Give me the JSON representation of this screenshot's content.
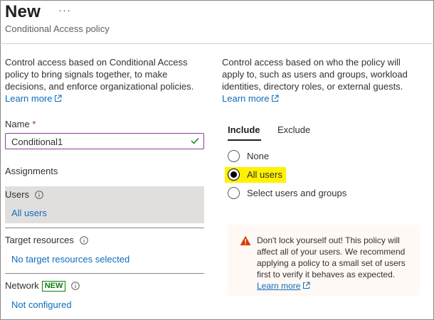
{
  "header": {
    "title": "New",
    "more_label": "···",
    "subtitle": "Conditional Access policy"
  },
  "left": {
    "description": "Control access based on Conditional Access policy to bring signals together, to make decisions, and enforce organizational policies.",
    "learn_more": "Learn more",
    "name_label": "Name",
    "required_marker": "*",
    "name_value": "Conditional1",
    "assignments_label": "Assignments",
    "users": {
      "title": "Users",
      "value": "All users"
    },
    "target_resources": {
      "title": "Target resources",
      "value": "No target resources selected"
    },
    "network": {
      "title": "Network",
      "badge": "NEW",
      "value": "Not configured"
    }
  },
  "right": {
    "description": "Control access based on who the policy will apply to, such as users and groups, workload identities, directory roles, or external guests.",
    "learn_more": "Learn more",
    "tabs": [
      {
        "label": "Include",
        "active": true
      },
      {
        "label": "Exclude",
        "active": false
      }
    ],
    "options": [
      {
        "label": "None",
        "selected": false
      },
      {
        "label": "All users",
        "selected": true
      },
      {
        "label": "Select users and groups",
        "selected": false
      }
    ],
    "warning": {
      "text": "Don't lock yourself out! This policy will affect all of your users. We recommend applying a policy to a small set of users first to verify it behaves as expected.",
      "learn_more": "Learn more"
    }
  },
  "colors": {
    "link": "#0f6cbd",
    "input_border": "#8a3c9c",
    "highlight": "#fff100",
    "badge": "#107c10",
    "warning_icon": "#d83b01",
    "selected_row_bg": "#e1dfdd"
  },
  "icons": [
    "more-icon",
    "external-link-icon",
    "check-icon",
    "info-icon",
    "warning-icon"
  ]
}
